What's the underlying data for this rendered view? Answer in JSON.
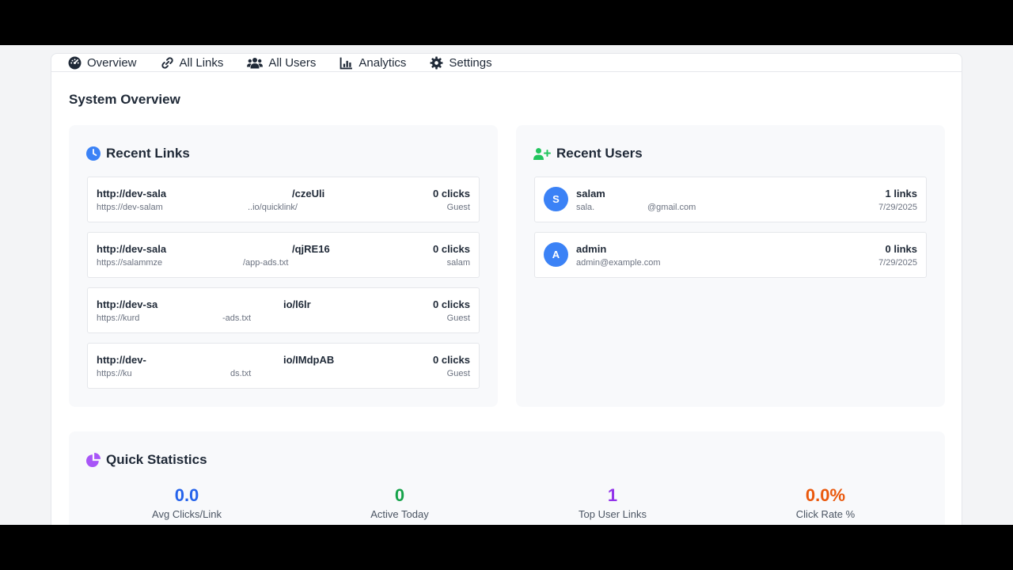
{
  "tabs": [
    {
      "label": "Overview",
      "icon": "dashboard-icon"
    },
    {
      "label": "All Links",
      "icon": "link-icon"
    },
    {
      "label": "All Users",
      "icon": "users-icon"
    },
    {
      "label": "Analytics",
      "icon": "chart-icon"
    },
    {
      "label": "Settings",
      "icon": "gear-icon"
    }
  ],
  "page_title": "System Overview",
  "recent_links": {
    "title": "Recent Links",
    "icon": "clock-icon",
    "items": [
      {
        "short_start": "http://dev-sala",
        "short_end": "/czeUli",
        "orig_start": "https://dev-salam",
        "orig_end": "..io/quicklink/",
        "clicks": "0 clicks",
        "owner": "Guest"
      },
      {
        "short_start": "http://dev-sala",
        "short_end": "/qjRE16",
        "orig_start": "https://salammze",
        "orig_end": "/app-ads.txt",
        "clicks": "0 clicks",
        "owner": "salam"
      },
      {
        "short_start": "http://dev-sa",
        "short_end": "io/l6lr",
        "orig_start": "https://kurd",
        "orig_end": "-ads.txt",
        "clicks": "0 clicks",
        "owner": "Guest"
      },
      {
        "short_start": "http://dev-",
        "short_end": "io/IMdpAB",
        "orig_start": "https://ku",
        "orig_end": "ds.txt",
        "clicks": "0 clicks",
        "owner": "Guest"
      }
    ]
  },
  "recent_users": {
    "title": "Recent Users",
    "icon": "user-plus-icon",
    "items": [
      {
        "initial": "S",
        "name": "salam",
        "email_start": "sala.",
        "email_end": "@gmail.com",
        "links": "1 links",
        "date": "7/29/2025"
      },
      {
        "initial": "A",
        "name": "admin",
        "email_start": "admin@example.com",
        "email_end": "",
        "links": "0 links",
        "date": "7/29/2025"
      }
    ]
  },
  "quick_stats": {
    "title": "Quick Statistics",
    "icon": "pie-chart-icon",
    "items": [
      {
        "value": "0.0",
        "label": "Avg Clicks/Link",
        "color": "#2563eb"
      },
      {
        "value": "0",
        "label": "Active Today",
        "color": "#16a34a"
      },
      {
        "value": "1",
        "label": "Top User Links",
        "color": "#9333ea"
      },
      {
        "value": "0.0%",
        "label": "Click Rate %",
        "color": "#ea580c"
      }
    ]
  },
  "colors": {
    "accent_blue": "#3b82f6",
    "user_green": "#22c55e",
    "stats_purple": "#a855f7"
  }
}
